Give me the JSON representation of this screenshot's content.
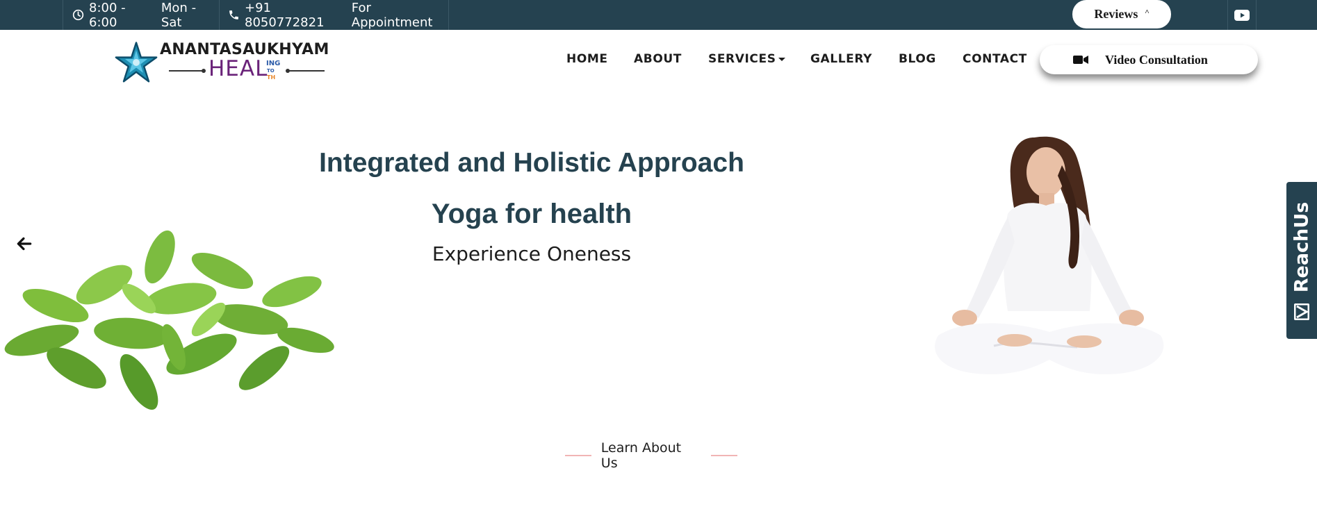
{
  "topbar": {
    "hours_time": "8:00 - 6:00",
    "hours_days": "Mon - Sat",
    "phone_number": "+91 8050772821",
    "phone_note": "For Appointment",
    "reviews_label": "Reviews",
    "reviews_caret": "˄",
    "social_icon": "youtube-icon",
    "bg_color": "#254250"
  },
  "logo": {
    "title": "ANANTASAUKHYAM",
    "heal": "HEAL",
    "ing": "ING",
    "to": "TO",
    "th": "TH",
    "star_color": "#1e8fb3"
  },
  "nav": {
    "items": [
      "HOME",
      "ABOUT",
      "SERVICES",
      "GALLERY",
      "BLOG",
      "CONTACT"
    ],
    "video_label": "Video Consultation"
  },
  "hero": {
    "title": "Integrated and Holistic Approach",
    "subtitle": "Yoga for health",
    "tagline": "Experience Oneness",
    "text_color": "#25424f"
  },
  "side_tab": {
    "label": "ReachUs"
  },
  "section": {
    "learn_label": "Learn About Us",
    "accent_color": "#f1b4b4"
  }
}
